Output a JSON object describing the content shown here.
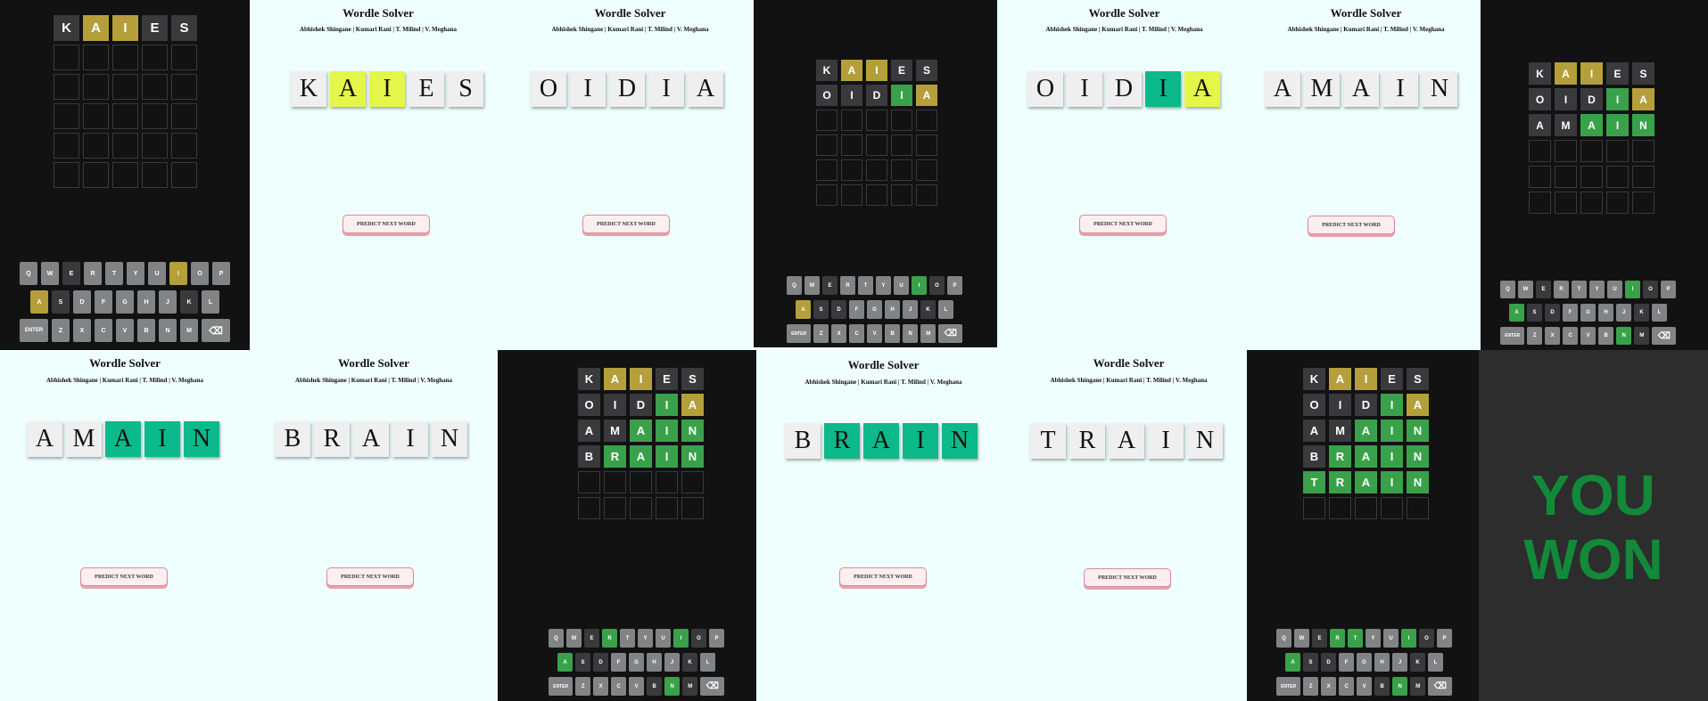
{
  "app": {
    "title": "Wordle Solver",
    "authors": "Abhishek Shingane | Kumari Rani | T. Milind | V. Meghana",
    "predict_label": "PREDICT NEXT WORD"
  },
  "colors": {
    "board_bg": "#121213",
    "absent": "#3a3a3c",
    "present": "#b59f3b",
    "correct": "#3aa14b",
    "solver_present": "#e4f64a",
    "solver_correct": "#0cb98a",
    "solver_bg": "#effffe",
    "won_text": "#13893a"
  },
  "boards": [
    {
      "rows": [
        [
          [
            "K",
            "g"
          ],
          [
            "A",
            "y"
          ],
          [
            "I",
            "y"
          ],
          [
            "E",
            "g"
          ],
          [
            "S",
            "g"
          ]
        ]
      ],
      "keys": {
        "Q": "u",
        "W": "u",
        "E": "g",
        "R": "u",
        "T": "u",
        "Y": "u",
        "U": "u",
        "I": "y",
        "O": "u",
        "P": "u",
        "A": "y",
        "S": "g",
        "D": "u",
        "F": "u",
        "G": "u",
        "H": "u",
        "J": "u",
        "K": "g",
        "L": "u",
        "Z": "u",
        "X": "u",
        "C": "u",
        "V": "u",
        "B": "u",
        "N": "u",
        "M": "u"
      }
    },
    {
      "rows": [
        [
          [
            "K",
            "g"
          ],
          [
            "A",
            "y"
          ],
          [
            "I",
            "y"
          ],
          [
            "E",
            "g"
          ],
          [
            "S",
            "g"
          ]
        ],
        [
          [
            "O",
            "g"
          ],
          [
            "I",
            "g"
          ],
          [
            "D",
            "g"
          ],
          [
            "I",
            "c"
          ],
          [
            "A",
            "y"
          ]
        ]
      ],
      "keys": {
        "Q": "u",
        "W": "u",
        "E": "g",
        "R": "u",
        "T": "u",
        "Y": "u",
        "U": "u",
        "I": "c",
        "O": "g",
        "P": "u",
        "A": "y",
        "S": "g",
        "D": "g",
        "F": "u",
        "G": "u",
        "H": "u",
        "J": "u",
        "K": "g",
        "L": "u",
        "Z": "u",
        "X": "u",
        "C": "u",
        "V": "u",
        "B": "u",
        "N": "u",
        "M": "u"
      }
    },
    {
      "rows": [
        [
          [
            "K",
            "g"
          ],
          [
            "A",
            "y"
          ],
          [
            "I",
            "y"
          ],
          [
            "E",
            "g"
          ],
          [
            "S",
            "g"
          ]
        ],
        [
          [
            "O",
            "g"
          ],
          [
            "I",
            "g"
          ],
          [
            "D",
            "g"
          ],
          [
            "I",
            "c"
          ],
          [
            "A",
            "y"
          ]
        ],
        [
          [
            "A",
            "g"
          ],
          [
            "M",
            "g"
          ],
          [
            "A",
            "c"
          ],
          [
            "I",
            "c"
          ],
          [
            "N",
            "c"
          ]
        ]
      ],
      "keys": {
        "Q": "u",
        "W": "u",
        "E": "g",
        "R": "u",
        "T": "u",
        "Y": "u",
        "U": "u",
        "I": "c",
        "O": "g",
        "P": "u",
        "A": "c",
        "S": "g",
        "D": "g",
        "F": "u",
        "G": "u",
        "H": "u",
        "J": "u",
        "K": "g",
        "L": "u",
        "Z": "u",
        "X": "u",
        "C": "u",
        "V": "u",
        "B": "u",
        "N": "c",
        "M": "g"
      }
    },
    {
      "rows": [
        [
          [
            "K",
            "g"
          ],
          [
            "A",
            "y"
          ],
          [
            "I",
            "y"
          ],
          [
            "E",
            "g"
          ],
          [
            "S",
            "g"
          ]
        ],
        [
          [
            "O",
            "g"
          ],
          [
            "I",
            "g"
          ],
          [
            "D",
            "g"
          ],
          [
            "I",
            "c"
          ],
          [
            "A",
            "y"
          ]
        ],
        [
          [
            "A",
            "g"
          ],
          [
            "M",
            "g"
          ],
          [
            "A",
            "c"
          ],
          [
            "I",
            "c"
          ],
          [
            "N",
            "c"
          ]
        ],
        [
          [
            "B",
            "g"
          ],
          [
            "R",
            "c"
          ],
          [
            "A",
            "c"
          ],
          [
            "I",
            "c"
          ],
          [
            "N",
            "c"
          ]
        ]
      ],
      "keys": {
        "Q": "u",
        "W": "u",
        "E": "g",
        "R": "c",
        "T": "u",
        "Y": "u",
        "U": "u",
        "I": "c",
        "O": "g",
        "P": "u",
        "A": "c",
        "S": "g",
        "D": "g",
        "F": "u",
        "G": "u",
        "H": "u",
        "J": "u",
        "K": "g",
        "L": "u",
        "Z": "u",
        "X": "u",
        "C": "u",
        "V": "u",
        "B": "g",
        "N": "c",
        "M": "g"
      }
    },
    {
      "rows": [
        [
          [
            "K",
            "g"
          ],
          [
            "A",
            "y"
          ],
          [
            "I",
            "y"
          ],
          [
            "E",
            "g"
          ],
          [
            "S",
            "g"
          ]
        ],
        [
          [
            "O",
            "g"
          ],
          [
            "I",
            "g"
          ],
          [
            "D",
            "g"
          ],
          [
            "I",
            "c"
          ],
          [
            "A",
            "y"
          ]
        ],
        [
          [
            "A",
            "g"
          ],
          [
            "M",
            "g"
          ],
          [
            "A",
            "c"
          ],
          [
            "I",
            "c"
          ],
          [
            "N",
            "c"
          ]
        ],
        [
          [
            "B",
            "g"
          ],
          [
            "R",
            "c"
          ],
          [
            "A",
            "c"
          ],
          [
            "I",
            "c"
          ],
          [
            "N",
            "c"
          ]
        ],
        [
          [
            "T",
            "c"
          ],
          [
            "R",
            "c"
          ],
          [
            "A",
            "c"
          ],
          [
            "I",
            "c"
          ],
          [
            "N",
            "c"
          ]
        ]
      ],
      "keys": {
        "Q": "u",
        "W": "u",
        "E": "g",
        "R": "c",
        "T": "c",
        "Y": "u",
        "U": "u",
        "I": "c",
        "O": "g",
        "P": "u",
        "A": "c",
        "S": "g",
        "D": "g",
        "F": "u",
        "G": "u",
        "H": "u",
        "J": "u",
        "K": "g",
        "L": "u",
        "Z": "u",
        "X": "u",
        "C": "u",
        "V": "u",
        "B": "g",
        "N": "c",
        "M": "g"
      }
    }
  ],
  "solver_words": [
    [
      [
        "K",
        "w"
      ],
      [
        "A",
        "y"
      ],
      [
        "I",
        "y"
      ],
      [
        "E",
        "w"
      ],
      [
        "S",
        "w"
      ]
    ],
    [
      [
        "O",
        "w"
      ],
      [
        "I",
        "w"
      ],
      [
        "D",
        "w"
      ],
      [
        "I",
        "w"
      ],
      [
        "A",
        "w"
      ]
    ],
    [
      [
        "O",
        "w"
      ],
      [
        "I",
        "w"
      ],
      [
        "D",
        "w"
      ],
      [
        "I",
        "c"
      ],
      [
        "A",
        "y"
      ]
    ],
    [
      [
        "A",
        "w"
      ],
      [
        "M",
        "w"
      ],
      [
        "A",
        "w"
      ],
      [
        "I",
        "w"
      ],
      [
        "N",
        "w"
      ]
    ],
    [
      [
        "A",
        "w"
      ],
      [
        "M",
        "w"
      ],
      [
        "A",
        "c"
      ],
      [
        "I",
        "c"
      ],
      [
        "N",
        "c"
      ]
    ],
    [
      [
        "B",
        "w"
      ],
      [
        "R",
        "w"
      ],
      [
        "A",
        "w"
      ],
      [
        "I",
        "w"
      ],
      [
        "N",
        "w"
      ]
    ],
    [
      [
        "B",
        "w"
      ],
      [
        "R",
        "c"
      ],
      [
        "A",
        "c"
      ],
      [
        "I",
        "c"
      ],
      [
        "N",
        "c"
      ]
    ],
    [
      [
        "T",
        "w"
      ],
      [
        "R",
        "w"
      ],
      [
        "A",
        "w"
      ],
      [
        "I",
        "w"
      ],
      [
        "N",
        "w"
      ]
    ]
  ],
  "keyboard": {
    "row1": [
      "Q",
      "W",
      "E",
      "R",
      "T",
      "Y",
      "U",
      "I",
      "O",
      "P"
    ],
    "row2": [
      "A",
      "S",
      "D",
      "F",
      "G",
      "H",
      "J",
      "K",
      "L"
    ],
    "row3": [
      "Z",
      "X",
      "C",
      "V",
      "B",
      "N",
      "M"
    ],
    "enter_label": "ENTER",
    "backspace_icon": "⌫"
  },
  "won": {
    "line1": "YOU",
    "line2": "WON"
  }
}
